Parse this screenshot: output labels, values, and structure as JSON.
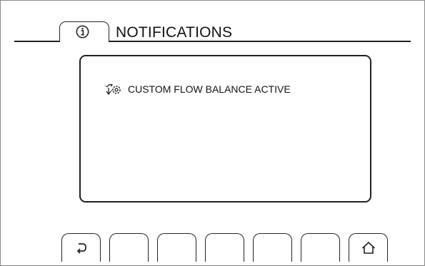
{
  "header": {
    "title": "NOTIFICATIONS",
    "tab_icon": "info-icon"
  },
  "notifications": [
    {
      "icon": "flow-balance-settings-icon",
      "text": "CUSTOM FLOW BALANCE ACTIVE"
    }
  ],
  "softkeys": [
    {
      "icon": "back-icon",
      "label": ""
    },
    {
      "icon": "",
      "label": ""
    },
    {
      "icon": "",
      "label": ""
    },
    {
      "icon": "",
      "label": ""
    },
    {
      "icon": "",
      "label": ""
    },
    {
      "icon": "",
      "label": ""
    },
    {
      "icon": "home-icon",
      "label": ""
    }
  ]
}
